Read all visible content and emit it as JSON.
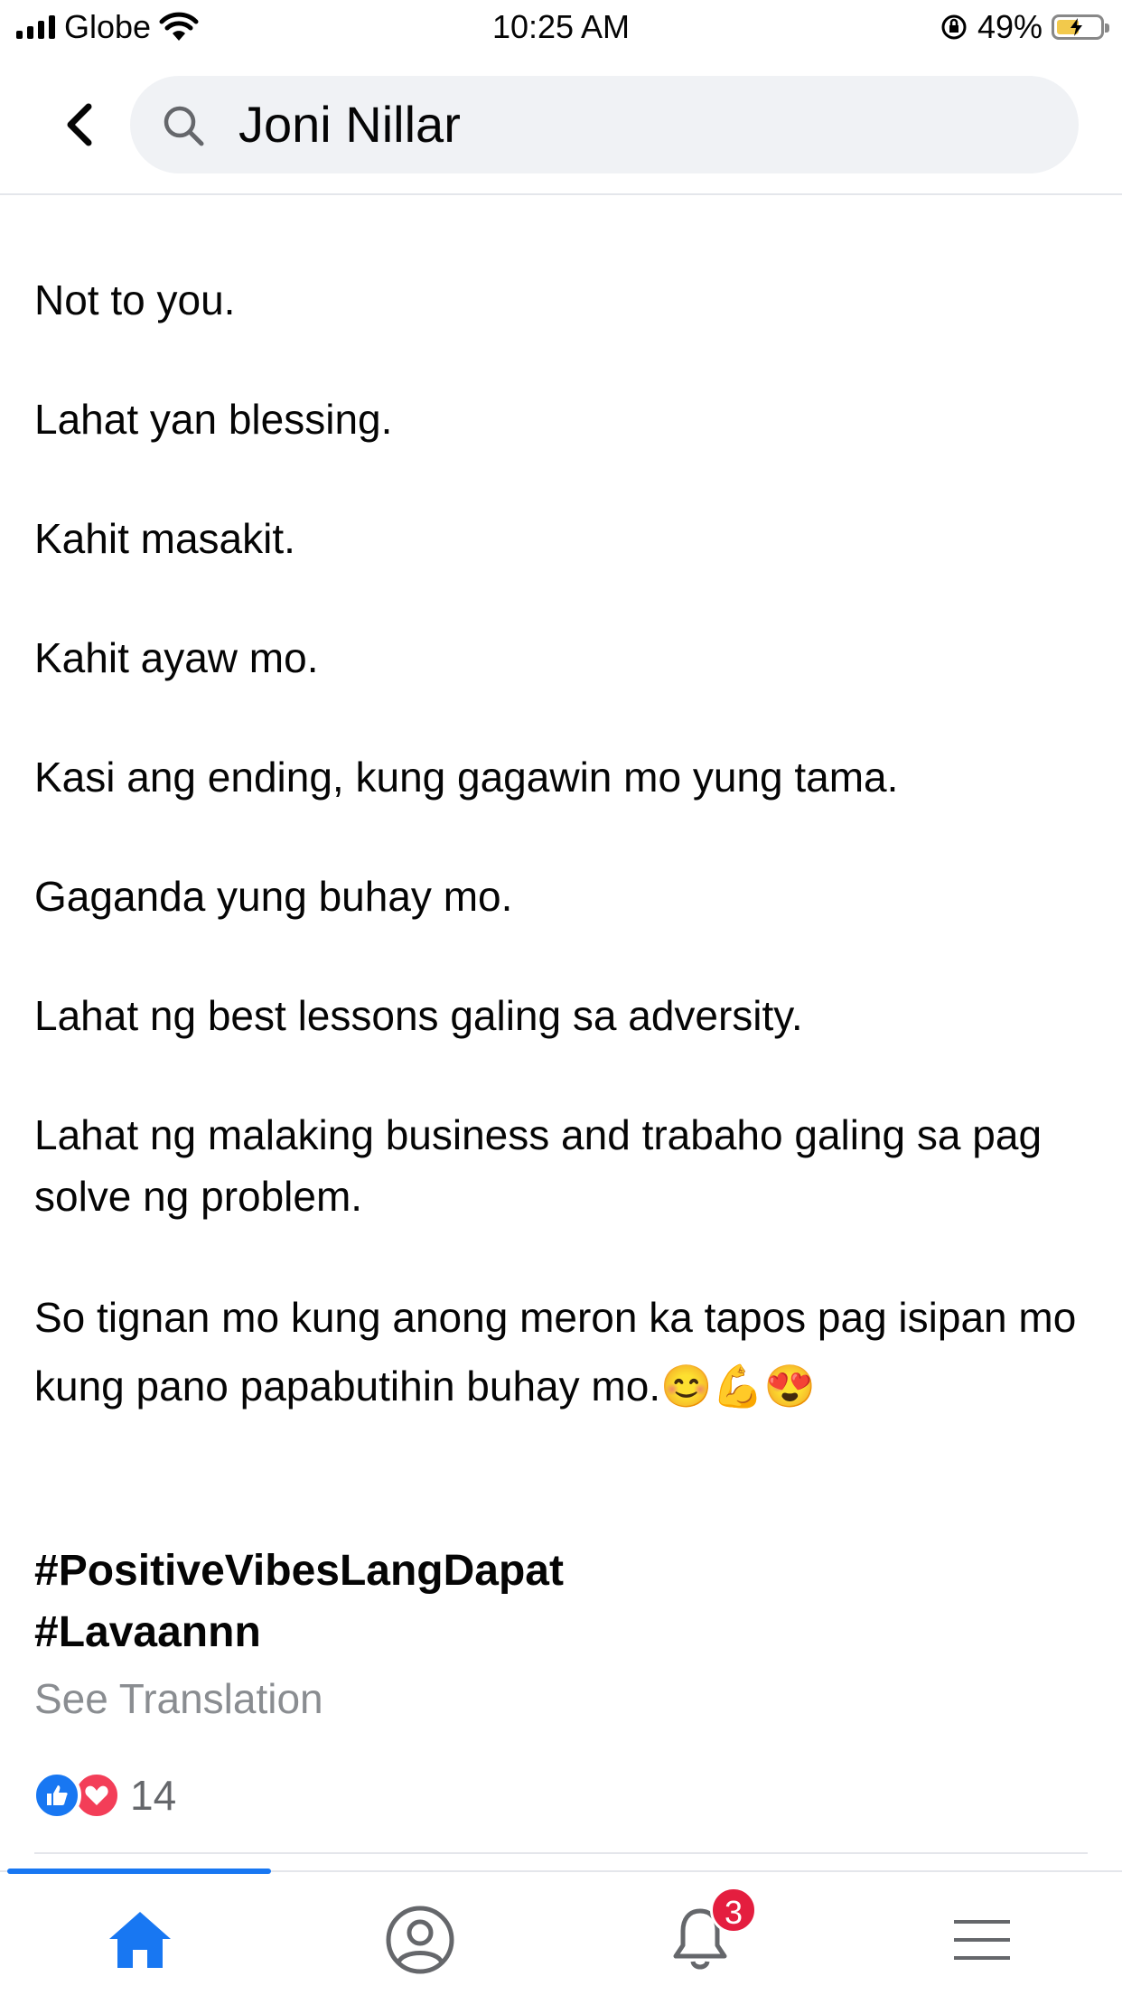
{
  "status_bar": {
    "carrier": "Globe",
    "time": "10:25 AM",
    "battery": "49%"
  },
  "header": {
    "search_text": "Joni Nillar"
  },
  "post": {
    "paragraphs": [
      "Not to you.",
      "Lahat yan blessing.",
      "Kahit masakit.",
      "Kahit ayaw mo.",
      "Kasi ang ending, kung gagawin mo yung tama.",
      "Gaganda yung buhay mo.",
      "Lahat ng best lessons galing sa adversity.",
      "Lahat ng malaking business and trabaho galing sa pag solve ng problem.",
      "So tignan mo kung anong meron ka tapos pag isipan mo kung pano papabutihin buhay mo.😊💪😍"
    ],
    "hashtags": [
      "#PositiveVibesLangDapat",
      "#Lavaannn"
    ],
    "see_translation": "See Translation",
    "reaction_count": "14"
  },
  "tabbar": {
    "notifications_badge": "3"
  },
  "colors": {
    "accent": "#1877f2",
    "badge": "#e41e3f",
    "love": "#f33e58"
  }
}
